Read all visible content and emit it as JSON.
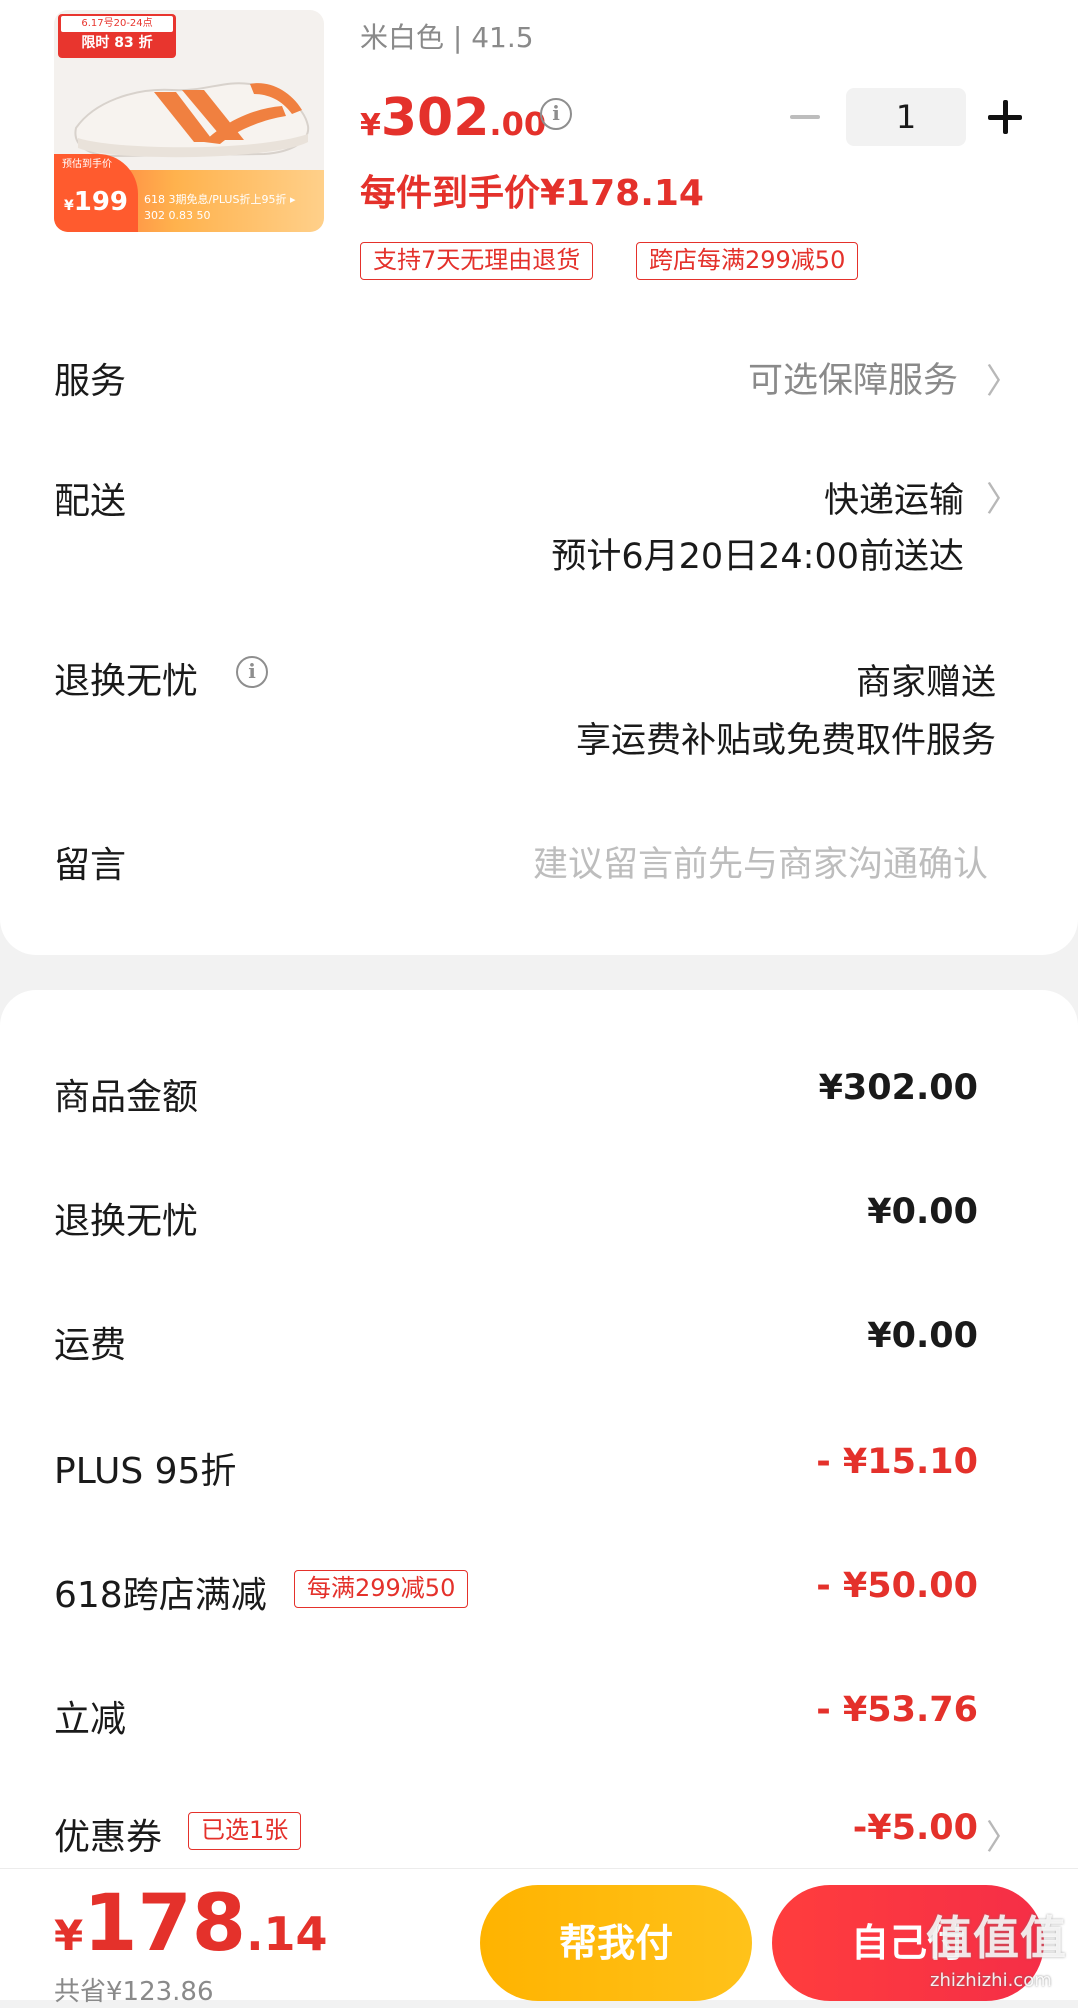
{
  "product": {
    "thumb_tag_top": "6.17号20-24点",
    "thumb_tag": "限时 83 折",
    "thumb_badge_caption": "预估到手价",
    "thumb_badge_price": "199",
    "thumb_badge_currency": "¥",
    "thumb_band_text": "618 3期免息/PLUS折上95折 ▸",
    "thumb_band_values": "302   0.83   50",
    "variant": "米白色 | 41.5",
    "price_currency": "¥",
    "price_int": "302",
    "price_dec": ".00",
    "quantity": "1",
    "landed_price": "每件到手价¥178.14",
    "tags": [
      "支持7天无理由退货",
      "跨店每满299减50"
    ]
  },
  "details": {
    "service_label": "服务",
    "service_value": "可选保障服务",
    "delivery_label": "配送",
    "delivery_value": "快递运输",
    "delivery_eta": "预计6月20日24:00前送达",
    "returns_label": "退换无忧",
    "returns_value": "商家赠送",
    "returns_sub": "享运费补贴或免费取件服务",
    "message_label": "留言",
    "message_placeholder": "建议留言前先与商家沟通确认"
  },
  "summary": {
    "rows": [
      {
        "label": "商品金额",
        "value": "¥302.00"
      },
      {
        "label": "退换无忧",
        "value": "¥0.00"
      },
      {
        "label": "运费",
        "value": "¥0.00"
      },
      {
        "label": "PLUS 95折",
        "value": "- ¥15.10"
      },
      {
        "label": "618跨店满减",
        "tag": "每满299减50",
        "value": "- ¥50.00"
      },
      {
        "label": "立减",
        "value": "- ¥53.76"
      },
      {
        "label": "优惠券",
        "tag": "已选1张",
        "value": "-¥5.00"
      }
    ]
  },
  "footer": {
    "total_currency": "¥",
    "total_int": "178",
    "total_dec": ".14",
    "saved": "共省¥123.86",
    "help_pay_label": "帮我付",
    "self_pay_label": "自己付",
    "watermark": "值值值",
    "watermark_url": "zhizhizhi.com"
  },
  "colors": {
    "accent": "#e4312b",
    "help_button": "#ffb300",
    "self_button": "#f52e47"
  }
}
